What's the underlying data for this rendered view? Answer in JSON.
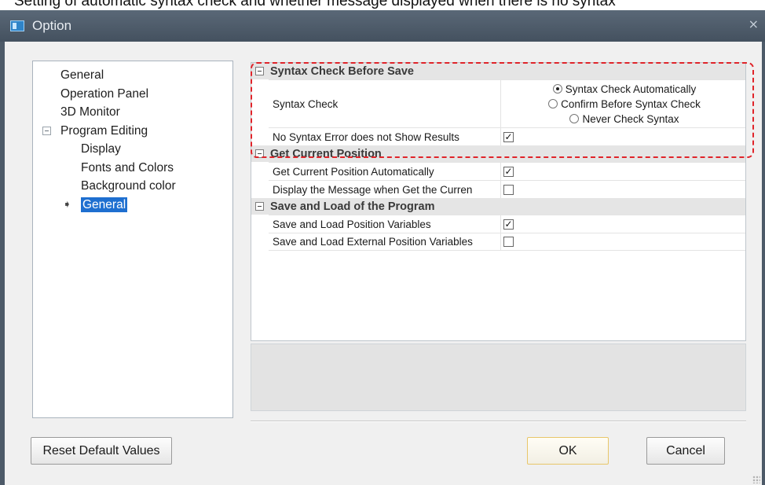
{
  "caption_top": "Setting of automatic syntax check and whether message displayed when there is no syntax",
  "window": {
    "title": "Option",
    "close_glyph": "×"
  },
  "tree": {
    "items": [
      {
        "label": "General",
        "level": 0
      },
      {
        "label": "Operation Panel",
        "level": 0
      },
      {
        "label": "3D Monitor",
        "level": 0
      },
      {
        "label": "Program Editing",
        "level": 0,
        "expanded": true
      },
      {
        "label": "Display",
        "level": 1
      },
      {
        "label": "Fonts and Colors",
        "level": 1
      },
      {
        "label": "Background color",
        "level": 1
      },
      {
        "label": "General",
        "level": 1,
        "selected": true
      }
    ],
    "current_arrow": "➧"
  },
  "property_grid": {
    "categories": [
      {
        "title": "Syntax Check Before Save",
        "rows": [
          {
            "name": "Syntax Check",
            "type": "radio",
            "options": [
              "Syntax Check Automatically",
              "Confirm Before Syntax Check",
              "Never Check Syntax"
            ],
            "selected_index": 0
          },
          {
            "name": "No Syntax Error does not Show Results",
            "type": "checkbox",
            "checked": true
          }
        ]
      },
      {
        "title": "Get Current Position",
        "rows": [
          {
            "name": "Get Current Position Automatically",
            "type": "checkbox",
            "checked": true
          },
          {
            "name": "Display the Message when Get the Curren",
            "type": "checkbox",
            "checked": false
          }
        ]
      },
      {
        "title": "Save and Load of the Program",
        "rows": [
          {
            "name": "Save and Load Position Variables",
            "type": "checkbox",
            "checked": true
          },
          {
            "name": "Save and Load External Position Variables",
            "type": "checkbox",
            "checked": false
          }
        ]
      }
    ],
    "check_glyph": "✓"
  },
  "buttons": {
    "reset": "Reset Default Values",
    "ok": "OK",
    "cancel": "Cancel"
  },
  "colors": {
    "highlight_border": "#e0242a",
    "selection": "#1e6fd0",
    "titlebar": "#4d5a68"
  }
}
